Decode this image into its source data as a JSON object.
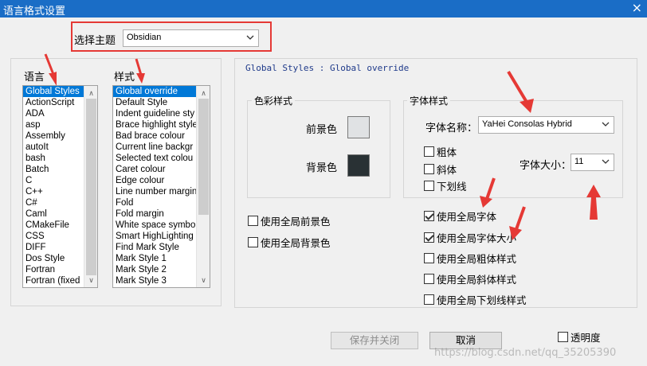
{
  "window": {
    "title": "语言格式设置",
    "close_glyph": "×"
  },
  "theme": {
    "label": "选择主题",
    "value": "Obsidian"
  },
  "language_list": {
    "label": "语言",
    "items": [
      "Global Styles",
      "ActionScript",
      "ADA",
      "asp",
      "Assembly",
      "autoIt",
      "bash",
      "Batch",
      "C",
      "C++",
      "C#",
      "Caml",
      "CMakeFile",
      "CSS",
      "DIFF",
      "Dos Style",
      "Fortran",
      "Fortran (fixed"
    ],
    "selected_index": 0
  },
  "style_list": {
    "label": "样式",
    "items": [
      "Global override",
      "Default Style",
      "Indent guideline sty",
      "Brace highlight style",
      "Bad brace colour",
      "Current line backgr",
      "Selected text colou",
      "Caret colour",
      "Edge colour",
      "Line number margin",
      "Fold",
      "Fold margin",
      "White space symbo",
      "Smart HighLighting",
      "Find Mark Style",
      "Mark Style 1",
      "Mark Style 2",
      "Mark Style 3"
    ],
    "selected_index": 0
  },
  "header_path": "Global Styles : Global override",
  "color_group": {
    "title": "色彩样式",
    "fg_label": "前景色",
    "bg_label": "背景色",
    "fg_color": "#e0e2e4",
    "bg_color": "#293134"
  },
  "font_group": {
    "title": "字体样式",
    "name_label": "字体名称：",
    "name_value": "YaHei Consolas Hybrid",
    "size_label": "字体大小：",
    "size_value": "11",
    "bold": "粗体",
    "italic": "斜体",
    "underline": "下划线"
  },
  "global_checks": {
    "fg": "使用全局前景色",
    "bg": "使用全局背景色",
    "font": "使用全局字体",
    "font_size": "使用全局字体大小",
    "bold": "使用全局粗体样式",
    "italic": "使用全局斜体样式",
    "underline": "使用全局下划线样式"
  },
  "buttons": {
    "save_close": "保存并关闭",
    "cancel": "取消"
  },
  "transparency_label": "透明度",
  "watermark": "https://blog.csdn.net/qq_35205390",
  "colors": {
    "titlebar": "#1a6dc6",
    "highlight_box": "#e53935",
    "selection": "#0078d7",
    "annotation_arrow": "#e53935"
  }
}
